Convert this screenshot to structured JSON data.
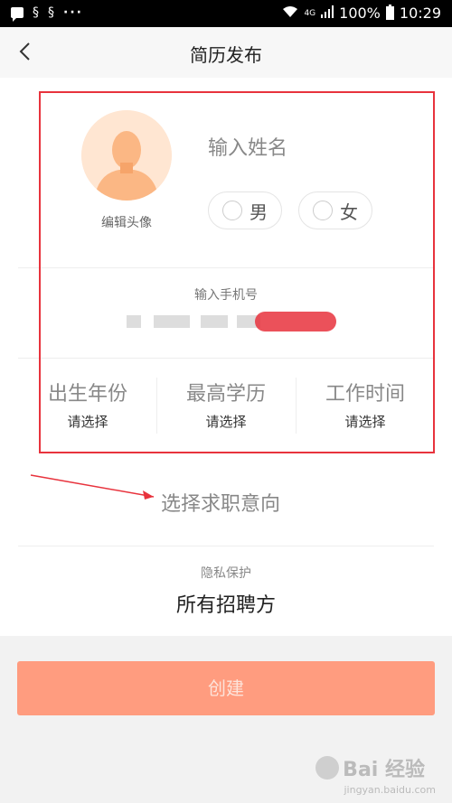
{
  "status_bar": {
    "dots": "···",
    "network": "4G",
    "battery": "100%",
    "time": "10:29"
  },
  "header": {
    "title": "简历发布"
  },
  "profile": {
    "avatar_label": "编辑头像",
    "name_placeholder": "输入姓名",
    "gender_male": "男",
    "gender_female": "女"
  },
  "phone": {
    "label": "输入手机号"
  },
  "pickers": [
    {
      "title": "出生年份",
      "value": "请选择"
    },
    {
      "title": "最高学历",
      "value": "请选择"
    },
    {
      "title": "工作时间",
      "value": "请选择"
    }
  ],
  "job_intention": {
    "placeholder": "选择求职意向"
  },
  "privacy": {
    "label": "隐私保护",
    "value": "所有招聘方"
  },
  "actions": {
    "create_label": "创建"
  },
  "watermark": {
    "text": "Bai 经验",
    "url": "jingyan.baidu.com"
  },
  "colors": {
    "accent": "#ff9c7f",
    "annotation": "#e8333d",
    "avatar_bg": "#ffe6d2"
  }
}
